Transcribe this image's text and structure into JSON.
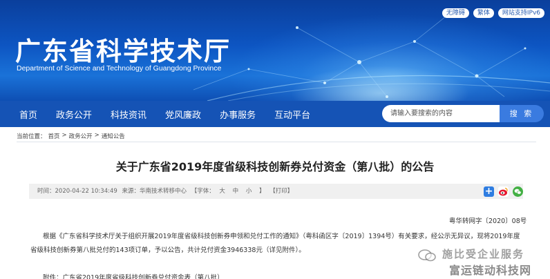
{
  "header": {
    "title": "广东省科学技术厅",
    "subtitle": "Department of Science and Technology of Guangdong Province",
    "top_links": [
      "无障碍",
      "繁体",
      "网站支持IPv6"
    ]
  },
  "nav": {
    "items": [
      "首页",
      "政务公开",
      "科技资讯",
      "党风廉政",
      "办事服务",
      "互动平台"
    ],
    "search_placeholder": "请输入要搜索的内容",
    "search_button": "搜 索"
  },
  "breadcrumb": {
    "prefix": "当前位置：",
    "items": [
      "首页",
      "政务公开",
      "通知公告"
    ],
    "separator": ">"
  },
  "article": {
    "title": "关于广东省2019年度省级科技创新券兑付资金（第八批）的公告",
    "meta": {
      "time": "时间：2020-04-22 10:34:49",
      "source": "来源：华南技术转移中心",
      "font_label": "【字体：",
      "font_sizes": [
        "大",
        "中",
        "小"
      ],
      "font_end": "】",
      "print": "【打印】"
    },
    "doc_number": "粤华转网字〔2020〕08号",
    "paragraph": "根据《广东省科学技术厅关于组织开展2019年度省级科技创新券申领和兑付工作的通知》（粤科函区字〔2019〕1394号）有关要求，经公示无异议，现将2019年度省级科技创新券第八批兑付的143项订单，予以公告，共计兑付资金3946338元（详见附件）。",
    "attachment": "附件：广东省2019年度省级科技创新券兑付资金表（第八批）"
  },
  "watermark": {
    "line1": "施比受企业服务",
    "line2": "富运链动科技网"
  },
  "colors": {
    "banner": "#0d55c2",
    "nav": "#1553b5",
    "search_button": "#3a7be0",
    "wechat": "#43b044",
    "share": "#2f7de1"
  }
}
